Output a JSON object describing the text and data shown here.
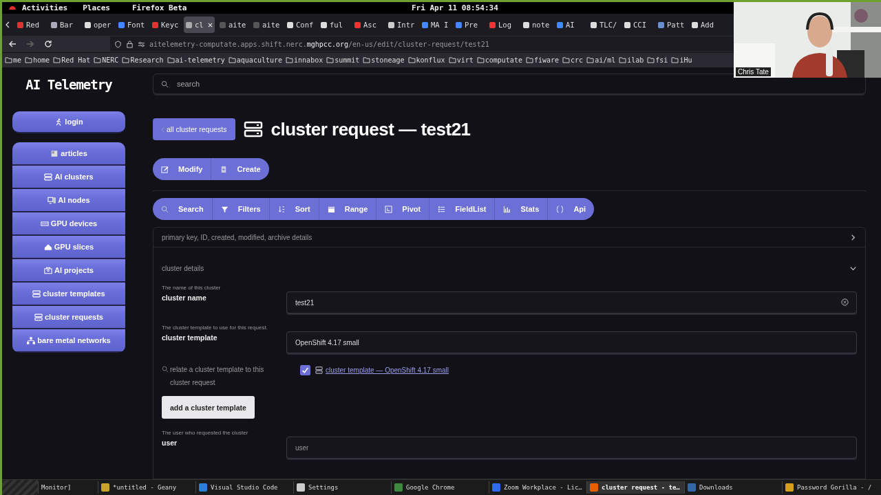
{
  "top_bar": {
    "activities": "Activities",
    "places": "Places",
    "app": "Firefox Beta",
    "clock": "Fri Apr 11 08:54:34"
  },
  "browser_tabs": [
    {
      "label": "Red",
      "selected": false
    },
    {
      "label": "Bar",
      "selected": false
    },
    {
      "label": "oper",
      "selected": false
    },
    {
      "label": "Font",
      "selected": false
    },
    {
      "label": "Keyc",
      "selected": false
    },
    {
      "label": "cl",
      "selected": true
    },
    {
      "label": "aite",
      "selected": false
    },
    {
      "label": "aite",
      "selected": false
    },
    {
      "label": "Conf",
      "selected": false
    },
    {
      "label": "ful",
      "selected": false
    },
    {
      "label": "Asc",
      "selected": false
    },
    {
      "label": "Intr",
      "selected": false
    },
    {
      "label": "MA I",
      "selected": false
    },
    {
      "label": "Pre",
      "selected": false
    },
    {
      "label": "Log",
      "selected": false
    },
    {
      "label": "note",
      "selected": false
    },
    {
      "label": "AI",
      "selected": false
    },
    {
      "label": "TLC/",
      "selected": false
    },
    {
      "label": "CCI",
      "selected": false
    },
    {
      "label": "Patt",
      "selected": false
    },
    {
      "label": "Add",
      "selected": false
    }
  ],
  "url": {
    "host_prefix": "aitelemetry-computate.apps.shift.nerc.",
    "domain": "mghpcc.org",
    "path": "/en-us/edit/cluster-request/test21"
  },
  "bookmarks": [
    "me",
    "home",
    "Red Hat",
    "NERC",
    "Research",
    "ai-telemetry",
    "aquaculture",
    "innabox",
    "summit",
    "stoneage",
    "konflux",
    "virt",
    "computate",
    "fiware",
    "crc",
    "ai/ml",
    "ilab",
    "fsi",
    "iHu"
  ],
  "webcam": {
    "kind": "picture",
    "name": "Chris Tate"
  },
  "logo": "AI Telemetry",
  "sidebar": {
    "login": "login",
    "items": [
      "articles",
      "AI clusters",
      "AI nodes",
      "GPU devices",
      "GPU slices",
      "AI projects",
      "cluster templates",
      "cluster requests",
      "bare metal networks"
    ]
  },
  "search": {
    "placeholder": "search"
  },
  "back_button": "all cluster requests",
  "page_title": "cluster request — test21",
  "actions": [
    "Modify",
    "Create"
  ],
  "toolbar": [
    "Search",
    "Filters",
    "Sort",
    "Range",
    "Pivot",
    "FieldList",
    "Stats",
    "Api"
  ],
  "sections": [
    {
      "title": "primary key, ID, created, modified, archive details",
      "expanded": false
    },
    {
      "title": "cluster details",
      "expanded": true
    }
  ],
  "fields": [
    {
      "hint": "The name of this cluster",
      "label": "cluster name",
      "value": "test21",
      "clearable": true
    },
    {
      "hint": "The cluster template to use for this request.",
      "label": "cluster template",
      "value": "OpenShift 4.17 small",
      "clearable": false
    }
  ],
  "relation": {
    "label": "relate a cluster template to this cluster request",
    "checked": true,
    "link": "cluster template — OpenShift 4.17 small",
    "button": "add a cluster template"
  },
  "user_field": {
    "hint": "The user who requested the cluster",
    "label": "user",
    "placeholder": "user"
  },
  "taskbar": [
    {
      "label": "Monitor]",
      "selected": false
    },
    {
      "label": "*untitled - Geany",
      "selected": false
    },
    {
      "label": "Visual Studio Code",
      "selected": false
    },
    {
      "label": "Settings",
      "selected": false
    },
    {
      "label": "Google Chrome",
      "selected": false
    },
    {
      "label": "Zoom Workplace - Lic…",
      "selected": false
    },
    {
      "label": "cluster request - te…",
      "selected": true
    },
    {
      "label": "Downloads",
      "selected": false
    },
    {
      "label": "Password Gorilla - /",
      "selected": false
    }
  ]
}
